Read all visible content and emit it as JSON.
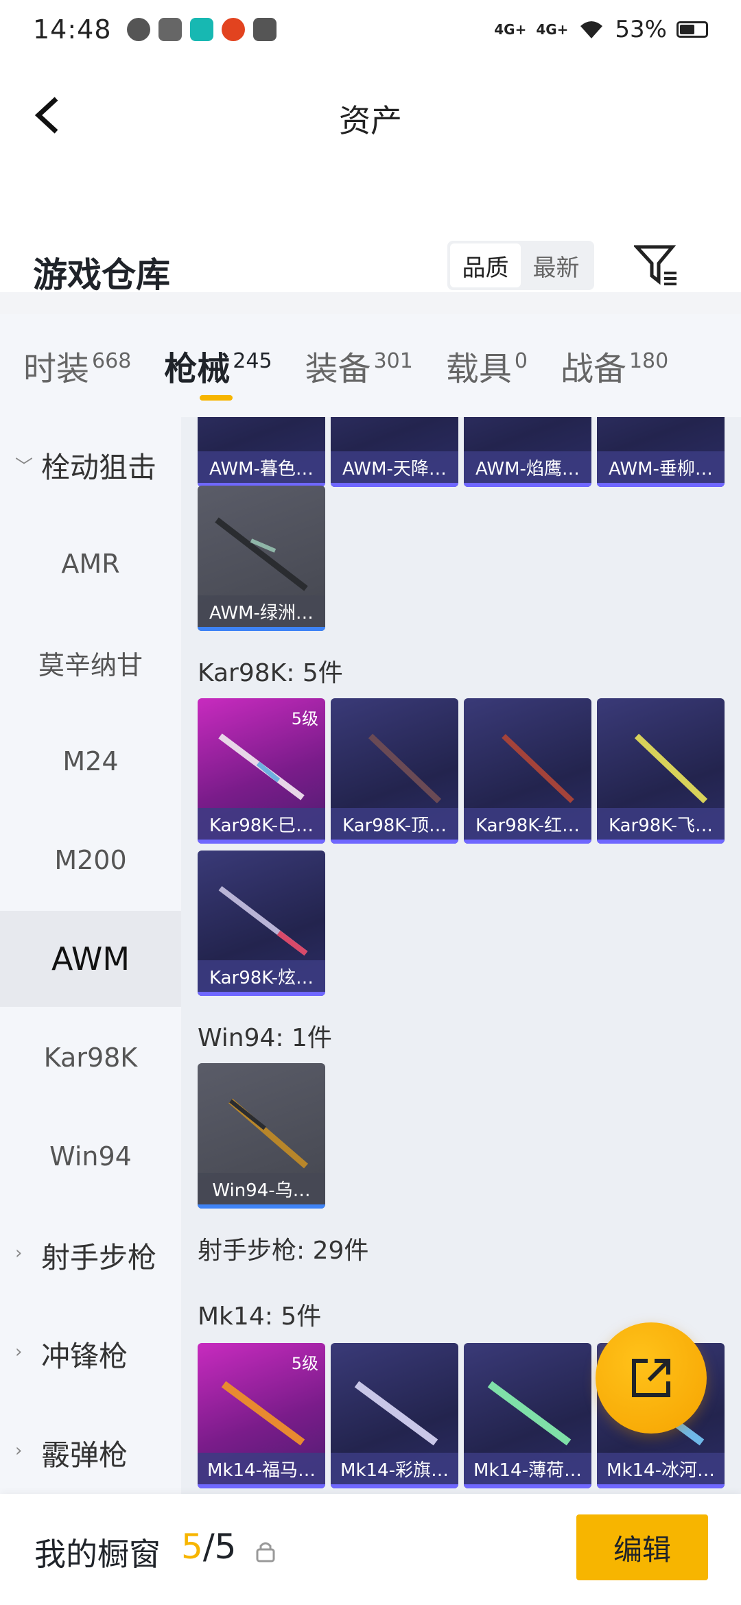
{
  "status_bar": {
    "time": "14:48",
    "net1": "4G+",
    "net2": "4G+",
    "battery": "53%"
  },
  "header": {
    "title": "资产",
    "warehouse": "游戏仓库",
    "sort_quality": "品质",
    "sort_newest": "最新"
  },
  "tabs": [
    {
      "label": "时装",
      "count": "668"
    },
    {
      "label": "枪械",
      "count": "245"
    },
    {
      "label": "装备",
      "count": "301"
    },
    {
      "label": "载具",
      "count": "0"
    },
    {
      "label": "战备",
      "count": "180"
    }
  ],
  "sidebar": {
    "cat1": "栓动狙击",
    "items": [
      "AMR",
      "莫辛纳甘",
      "M24",
      "M200",
      "AWM",
      "Kar98K",
      "Win94"
    ],
    "cat2": "射手步枪",
    "cat3": "冲锋枪",
    "cat4": "霰弹枪"
  },
  "awm_row": [
    "AWM-暮色…",
    "AWM-天降…",
    "AWM-焰鹰…",
    "AWM-垂柳…"
  ],
  "awm_extra": "AWM-绿洲…",
  "kar_title": "Kar98K: 5件",
  "kar_row": [
    "Kar98K-巳…",
    "Kar98K-顶…",
    "Kar98K-红…",
    "Kar98K-飞…"
  ],
  "kar_extra": "Kar98K-炫…",
  "win_title": "Win94: 1件",
  "win_item": "Win94-乌…",
  "dmr_title": "射手步枪: 29件",
  "mk_title": "Mk14: 5件",
  "mk_row": [
    "Mk14-福马…",
    "Mk14-彩旗…",
    "Mk14-薄荷…",
    "Mk14-冰河…"
  ],
  "level_badge": "5级",
  "bottom": {
    "label": "我的橱窗",
    "count_current": "5",
    "count_sep": "/",
    "count_total": "5",
    "edit": "编辑"
  }
}
